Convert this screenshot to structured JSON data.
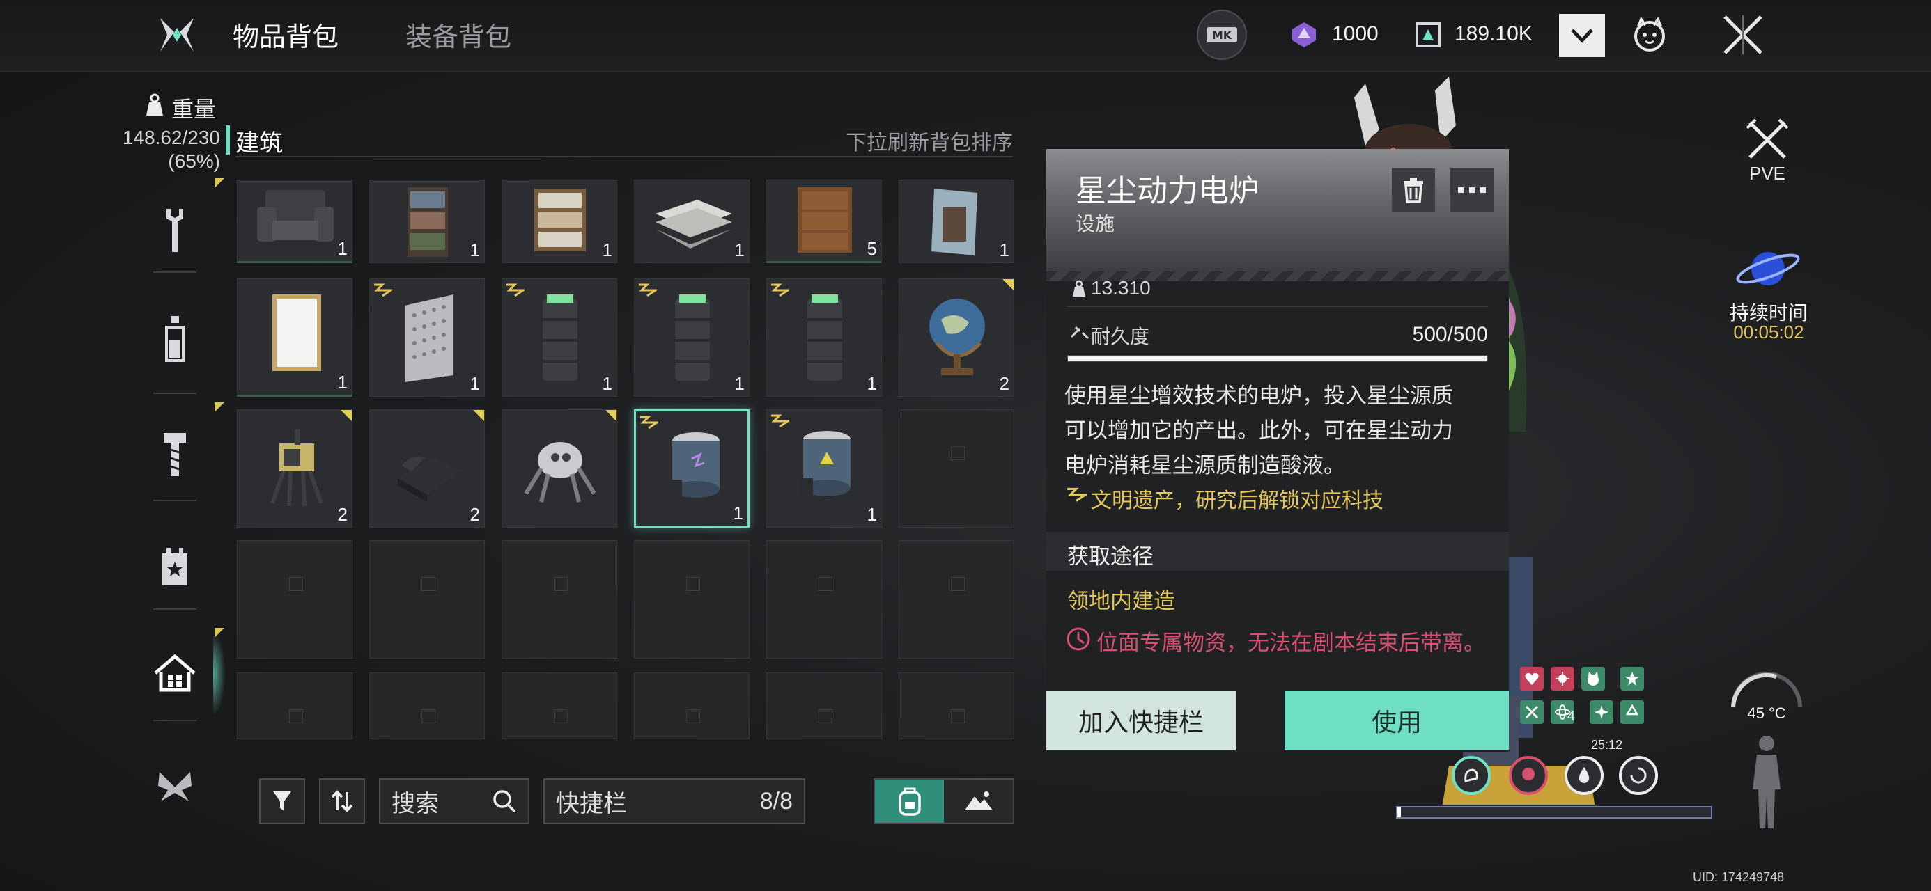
{
  "tabs": [
    {
      "label": "物品背包",
      "active": true
    },
    {
      "label": "装备背包",
      "active": false
    }
  ],
  "currency": [
    {
      "icon": "mk-badge-icon",
      "value": ""
    },
    {
      "icon": "purple-crystal-icon",
      "value": "1000"
    },
    {
      "icon": "cube-chip-icon",
      "value": "189.10K"
    }
  ],
  "weight": {
    "label": "重量",
    "value": "148.62/230",
    "percent": "(65%)"
  },
  "category": {
    "title": "建筑",
    "hint": "下拉刷新背包排序"
  },
  "side_nav": [
    {
      "name": "wrench-icon",
      "active": false
    },
    {
      "name": "bottle-icon",
      "active": false
    },
    {
      "name": "bolt-icon",
      "active": false
    },
    {
      "name": "calendar-star-icon",
      "active": false
    },
    {
      "name": "home-icon",
      "active": true
    },
    {
      "name": "butterfly-icon",
      "active": false
    }
  ],
  "grid": [
    {
      "item": "armchair",
      "count": "1",
      "corner": false,
      "tech": false
    },
    {
      "item": "bookshelf",
      "count": "1",
      "corner": false,
      "tech": false
    },
    {
      "item": "newspaper-rack",
      "count": "1",
      "corner": false,
      "tech": false
    },
    {
      "item": "newspaper-stack",
      "count": "1",
      "corner": false,
      "tech": false
    },
    {
      "item": "wooden-cabinet",
      "count": "5",
      "corner": false,
      "tech": false
    },
    {
      "item": "poster",
      "count": "1",
      "corner": false,
      "tech": false
    },
    {
      "item": "picture-frame",
      "count": "1",
      "corner": false,
      "tech": false
    },
    {
      "item": "metal-panel",
      "count": "1",
      "corner": false,
      "tech": true
    },
    {
      "item": "generator-tower",
      "count": "1",
      "corner": false,
      "tech": true
    },
    {
      "item": "generator-tower",
      "count": "1",
      "corner": false,
      "tech": true
    },
    {
      "item": "generator-tower",
      "count": "1",
      "corner": false,
      "tech": true
    },
    {
      "item": "globe",
      "count": "2",
      "corner": true,
      "tech": false
    },
    {
      "item": "robot-turret",
      "count": "2",
      "corner": true,
      "tech": false
    },
    {
      "item": "telephone",
      "count": "2",
      "corner": true,
      "tech": false
    },
    {
      "item": "spider-bot",
      "count": "",
      "corner": true,
      "tech": false
    },
    {
      "item": "stardust-furnace",
      "count": "1",
      "corner": false,
      "tech": true,
      "selected": true
    },
    {
      "item": "stardust-furnace-b",
      "count": "1",
      "corner": false,
      "tech": true
    }
  ],
  "detail": {
    "title": "星尘动力电炉",
    "subtitle": "设施",
    "weight": "13.310",
    "durability_label": "耐久度",
    "durability_value": "500/500",
    "durability_fraction": 1.0,
    "description": [
      "使用星尘增效技术的电炉，投入星尘源质",
      "可以增加它的产出。此外，可在星尘动力",
      "电炉消耗星尘源质制造酸液。"
    ],
    "tech_note": "文明遗产，研究后解锁对应科技",
    "source_header": "获取途径",
    "source": "领地内建造",
    "warning": "位面专属物资，无法在剧本结束后带离。",
    "btn_quickbar": "加入快捷栏",
    "btn_use": "使用"
  },
  "toolbar": {
    "search_placeholder": "搜索",
    "quickbar_label": "快捷栏",
    "quickbar_count": "8/8"
  },
  "right_hud": {
    "mode": "PVE",
    "duration_label": "持续时间",
    "duration_value": "00:05:02",
    "temperature": "45 °C",
    "timer": "25:12",
    "status_count": "4",
    "uid": "UID: 174249748"
  },
  "colors": {
    "accent": "#6fe0c3",
    "gold": "#e3c65a",
    "warning": "#d9506f",
    "duration": "#e3c65a"
  }
}
